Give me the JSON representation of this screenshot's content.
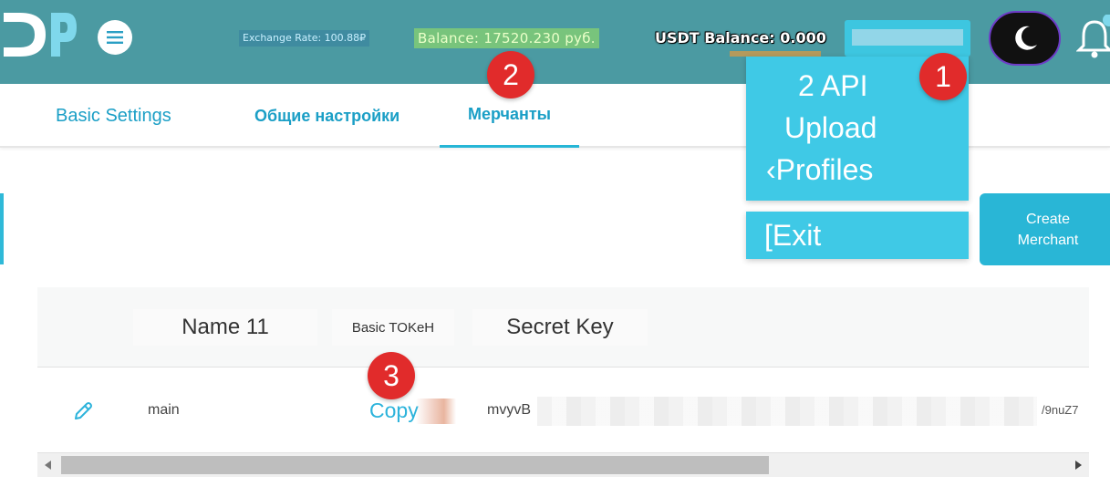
{
  "header": {
    "exchange_rate": "Exchange Rate: 100.88₽",
    "balance": "Balance: 17520.230 руб.",
    "usdt_balance": "USDT Balance: 0.000"
  },
  "tabs": [
    {
      "label": "Basic Settings"
    },
    {
      "label": "Общие настройки"
    },
    {
      "label": "Мерчанты"
    }
  ],
  "dropdown": {
    "items": [
      "2 API",
      "Upload",
      "Profiles"
    ],
    "profiles_prefix": "‹",
    "exit": "[Exit"
  },
  "create_button": "Create Merchant",
  "badges": [
    "1",
    "2",
    "3"
  ],
  "table": {
    "headers": [
      "Name 11",
      "Basic TOKeH",
      "Secret Key"
    ],
    "rows": [
      {
        "name": "main",
        "basic_token": "Copy",
        "secret_start": "mvyvB",
        "secret_end": "/9nuZ7"
      }
    ]
  },
  "colors": {
    "header_bg": "#4b9aa2",
    "accent": "#29b6d6",
    "badge": "#e12b2b"
  }
}
